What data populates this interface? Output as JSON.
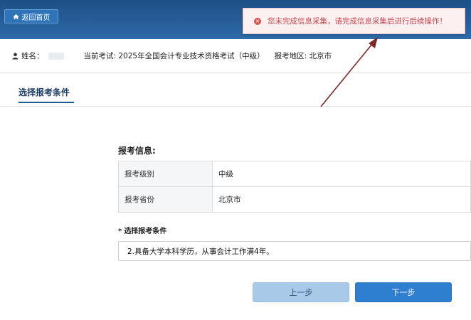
{
  "header": {
    "back_label": "返回首页"
  },
  "alert": {
    "message": "您未完成信息采集，请完成信息采集后进行后续操作！",
    "color": "#c5454f"
  },
  "infobar": {
    "name_label": "姓名：",
    "exam_text": "当前考试: 2025年全国会计专业技术资格考试（中级）",
    "region_text": "报考地区: 北京市"
  },
  "tabs": [
    {
      "label": "选择报考条件"
    }
  ],
  "section": {
    "title": "报考信息:",
    "rows": [
      {
        "label": "报考级别",
        "value": "中级"
      },
      {
        "label": "报考省份",
        "value": "北京市"
      }
    ]
  },
  "condition": {
    "label": "选择报考条件",
    "required_mark": "*",
    "value": "2.具备大学本科学历，从事会计工作满4年。"
  },
  "buttons": {
    "prev": "上一步",
    "next": "下一步"
  }
}
